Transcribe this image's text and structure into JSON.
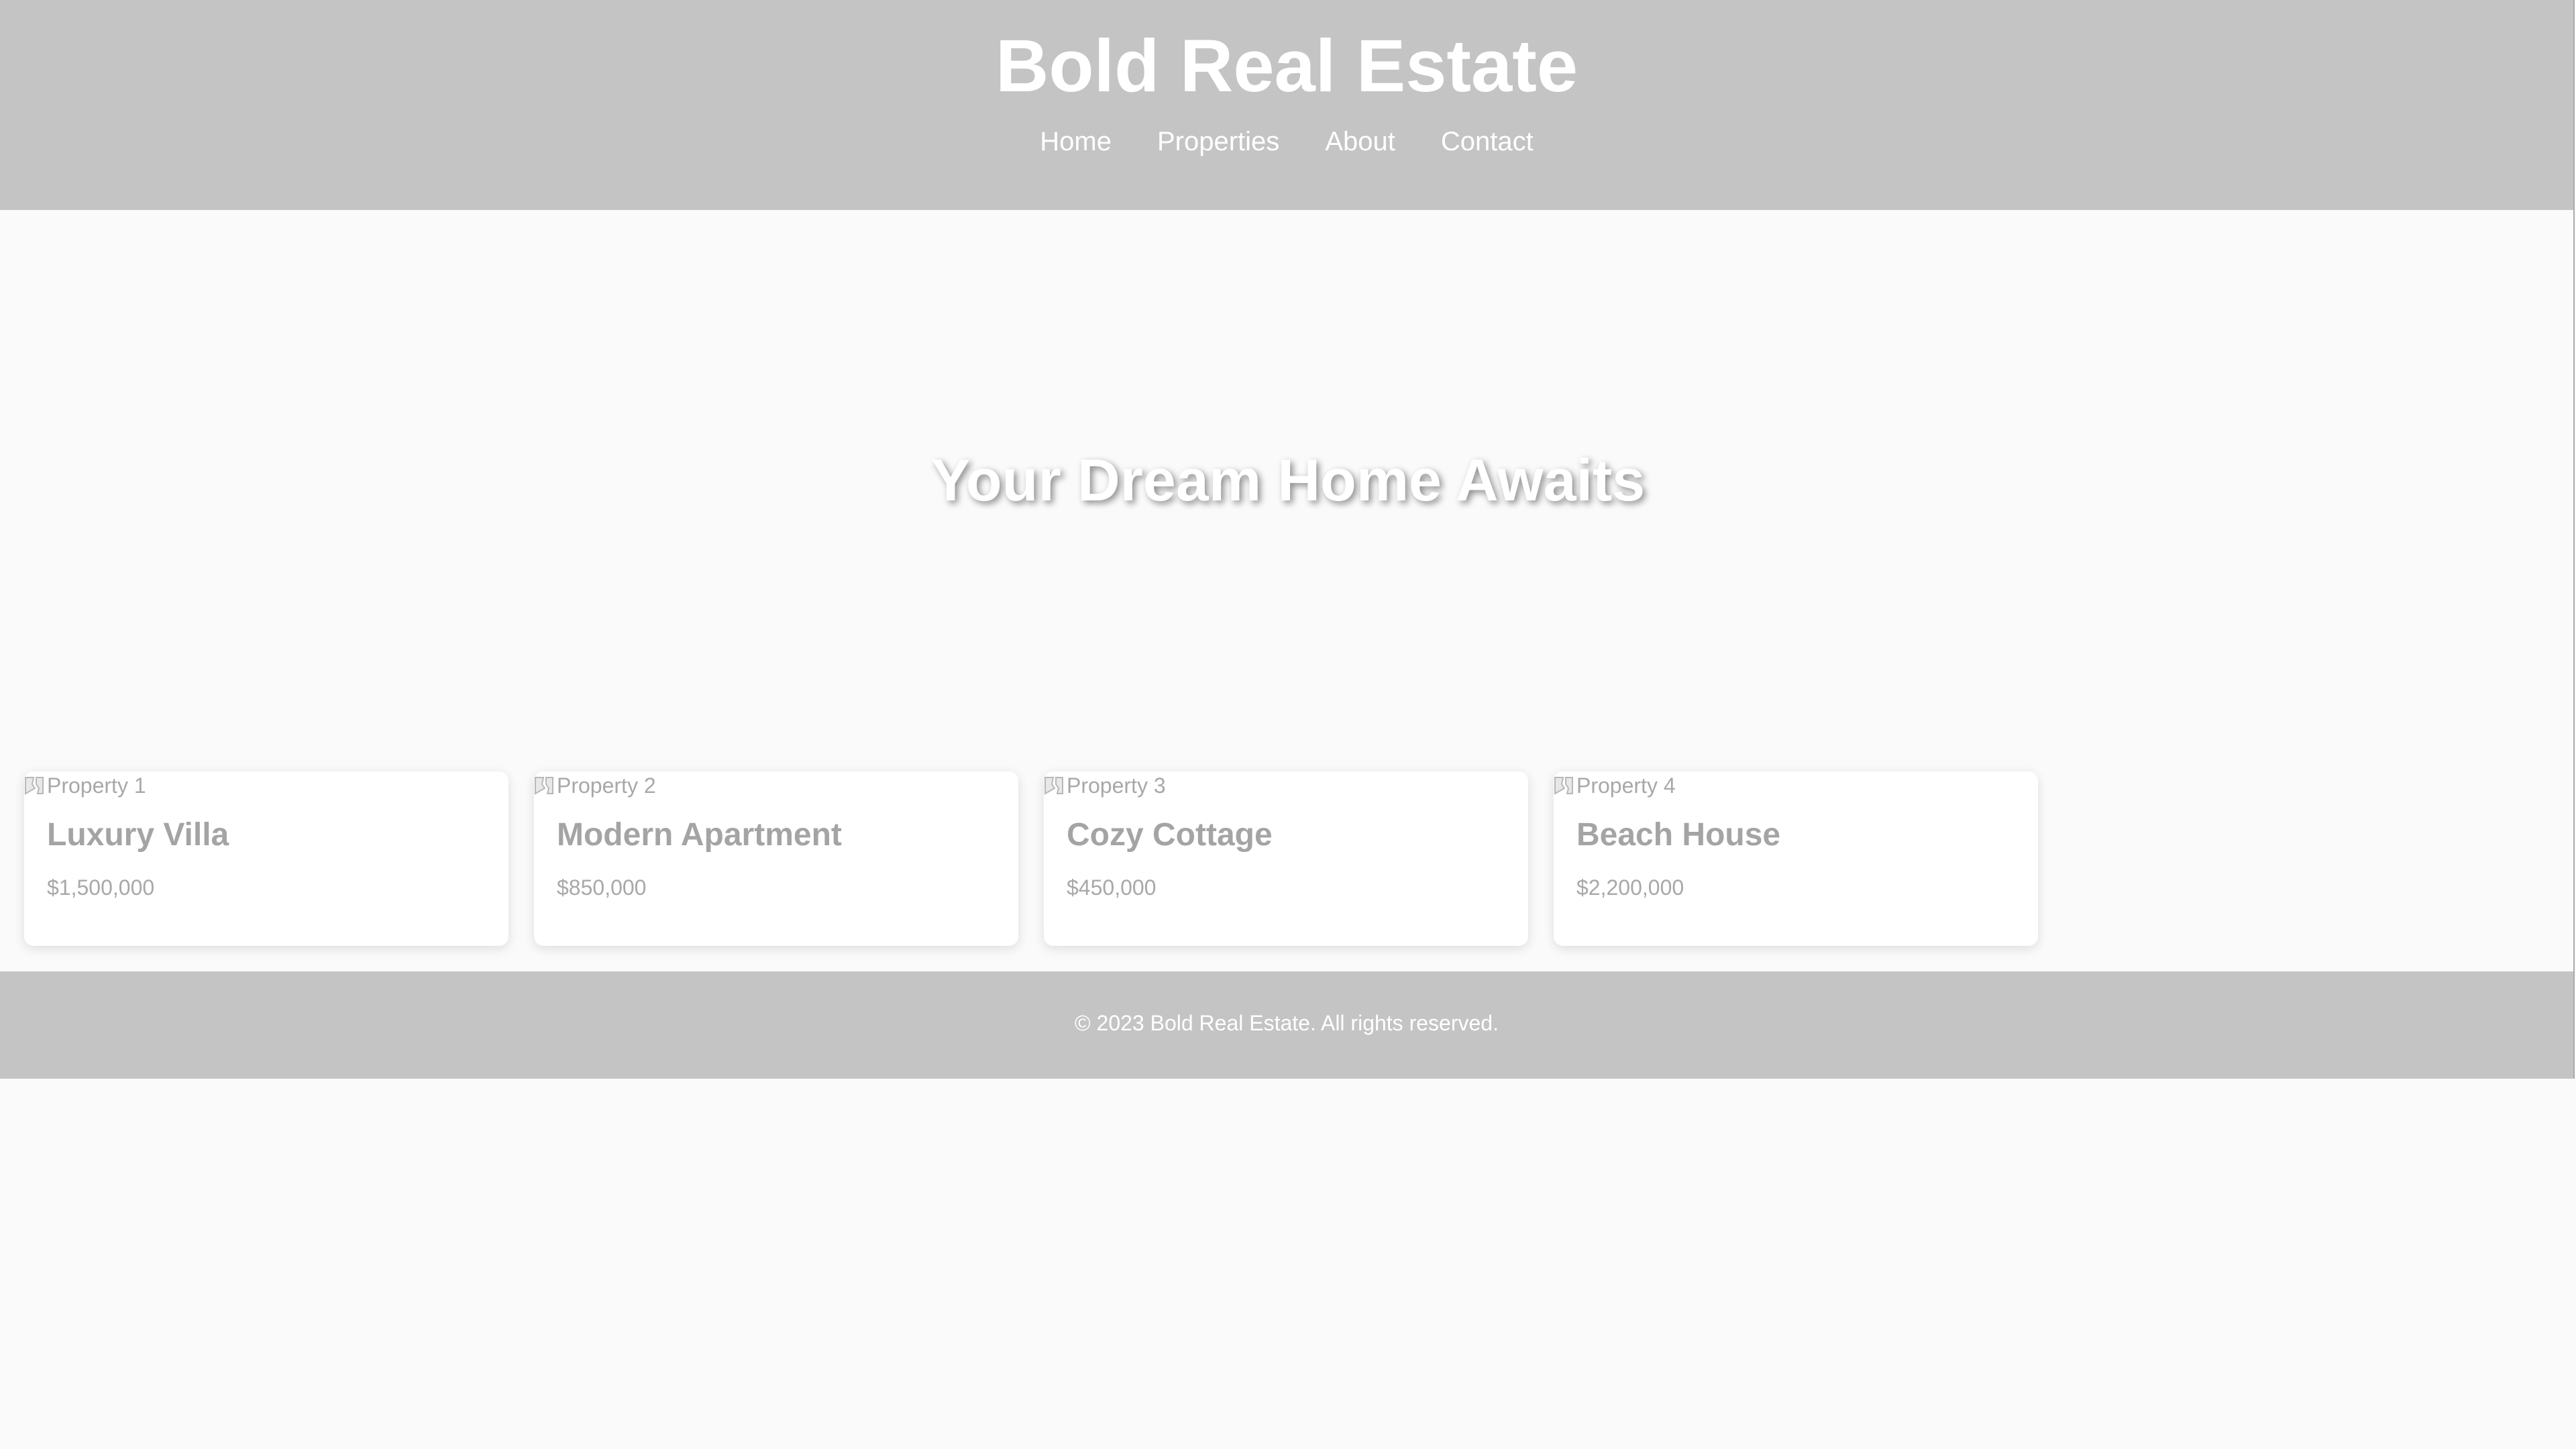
{
  "header": {
    "title": "Bold Real Estate",
    "nav": [
      {
        "label": "Home"
      },
      {
        "label": "Properties"
      },
      {
        "label": "About"
      },
      {
        "label": "Contact"
      }
    ]
  },
  "hero": {
    "heading": "Your Dream Home Awaits"
  },
  "properties": [
    {
      "image_alt": "Property 1",
      "title": "Luxury Villa",
      "price": "$1,500,000"
    },
    {
      "image_alt": "Property 2",
      "title": "Modern Apartment",
      "price": "$850,000"
    },
    {
      "image_alt": "Property 3",
      "title": "Cozy Cottage",
      "price": "$450,000"
    },
    {
      "image_alt": "Property 4",
      "title": "Beach House",
      "price": "$2,200,000"
    }
  ],
  "footer": {
    "text": "© 2023 Bold Real Estate. All rights reserved."
  },
  "colors": {
    "header_bg": "#c4c4c4",
    "page_bg": "#fafafa",
    "card_bg": "#ffffff",
    "muted_text": "#a8a8a8"
  },
  "icons": {
    "broken_image": "broken-image-icon"
  }
}
